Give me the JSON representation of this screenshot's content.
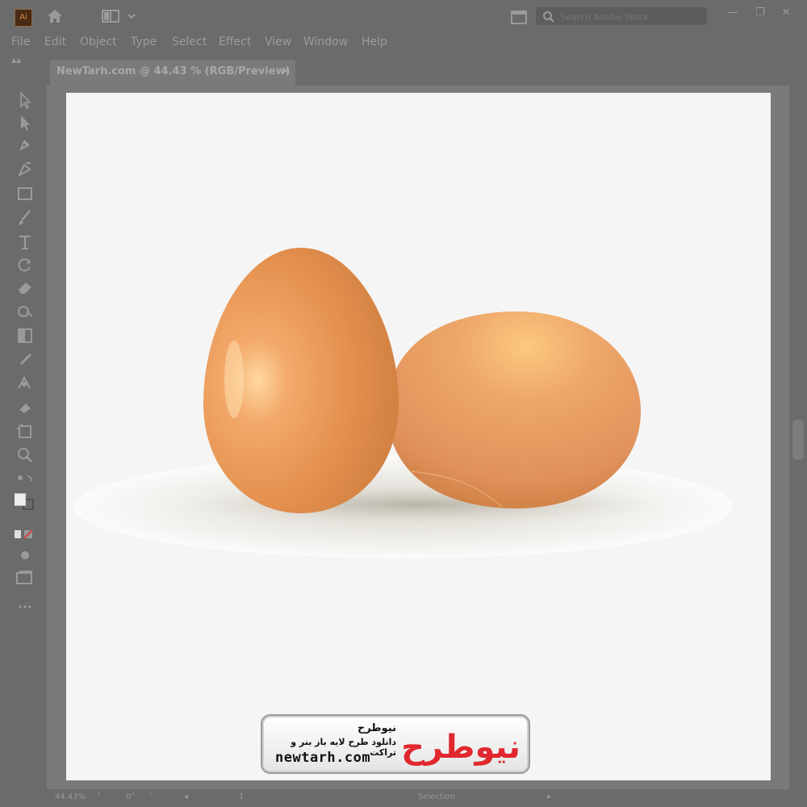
{
  "app": {
    "logo_text": "Ai"
  },
  "search": {
    "placeholder": "Search Adobe Stock"
  },
  "window": {
    "minimize": "—",
    "restore": "❐",
    "close": "✕"
  },
  "menu": {
    "items": [
      "File",
      "Edit",
      "Object",
      "Type",
      "Select",
      "Effect",
      "View",
      "Window",
      "Help"
    ]
  },
  "document": {
    "tab_title": "NewTarh.com @ 44.43 % (RGB/Preview)",
    "close": "×"
  },
  "tools": [
    "selection-tool",
    "direct-selection-tool",
    "pen-tool",
    "curvature-tool",
    "rectangle-tool",
    "paintbrush-tool",
    "type-tool",
    "rotate-tool",
    "eraser-tool",
    "shape-builder-tool",
    "gradient-tool",
    "eyedropper-tool",
    "blend-tool",
    "symbol-sprayer-tool",
    "artboard-tool",
    "zoom-tool",
    "swap-fill-stroke",
    "fill-stroke-swatch",
    "color-mode-buttons",
    "draw-mode",
    "screen-mode",
    "edit-toolbar"
  ],
  "status": {
    "zoom": "44.43%",
    "rotation": "0°",
    "artboard": "1",
    "tool": "Selection"
  },
  "colors": {
    "egg_base": "#e4904e",
    "egg_highlight": "#ffd7a0",
    "egg_shadow": "#c97a3e",
    "artboard": "#f5f5f5",
    "interface": "#6b6b6b"
  },
  "watermark": {
    "brand_fa": "نیوطرح",
    "tagline_fa": "دانلود طرح لایه باز بنر و تراکت",
    "url": "newtarh.com",
    "logo_fa": "نیوطرح"
  }
}
